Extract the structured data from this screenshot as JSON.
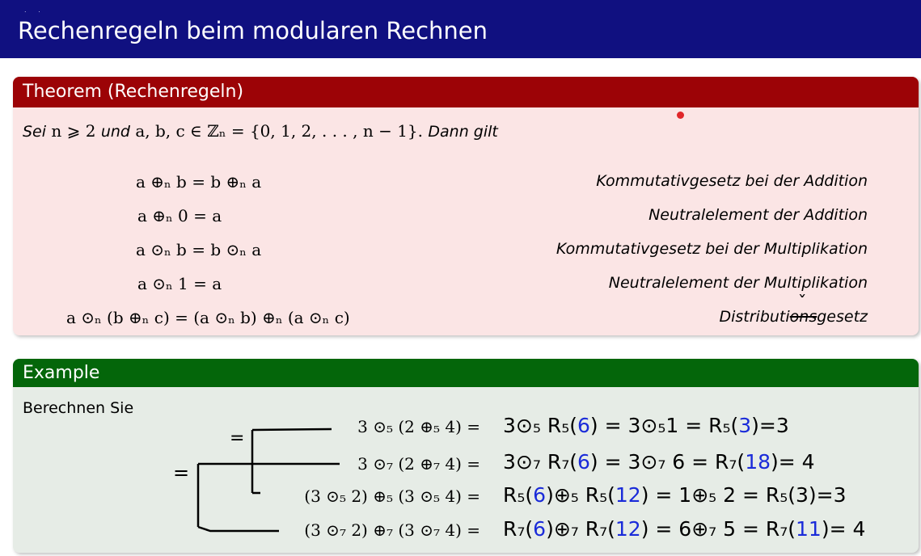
{
  "slide": {
    "title": "Rechenregeln beim modularen Rechnen",
    "nav_dots": ". ."
  },
  "theorem": {
    "heading": "Theorem (Rechenregeln)",
    "intro_sei": "Sei",
    "intro_math1": "n ⩾ 2",
    "intro_und": "und",
    "intro_math2": "a, b, c ∈ ℤₙ = {0, 1, 2, . . . , n − 1}.",
    "intro_dann": "Dann gilt",
    "rules": [
      {
        "formula": "a ⊕ₙ b = b ⊕ₙ a",
        "name": "Kommutativgesetz bei der Addition"
      },
      {
        "formula": "a ⊕ₙ 0 = a",
        "name": "Neutralelement der Addition"
      },
      {
        "formula": "a ⊙ₙ b = b ⊙ₙ a",
        "name": "Kommutativgesetz bei der Multiplikation"
      },
      {
        "formula": "a ⊙ₙ 1 = a",
        "name": "Neutralelement der Multiplikation"
      },
      {
        "formula": "a ⊙ₙ (b ⊕ₙ c) = (a ⊙ₙ b) ⊕ₙ (a ⊙ₙ c)",
        "name_prefix": "Distributi",
        "name_struck": "ons",
        "name_suffix": "gesetz",
        "name_insert": "ˇ"
      }
    ]
  },
  "example": {
    "heading": "Example",
    "prompt": "Berechnen Sie",
    "tasks": [
      {
        "expr": "3 ⊙₅ (2 ⊕₅ 4) =",
        "work": [
          "3⊙₅ R₅(",
          "6",
          ") = 3⊙₅1 = R₅(",
          "3",
          ")=3"
        ]
      },
      {
        "expr": "3 ⊙₇ (2 ⊕₇ 4) =",
        "work": [
          "3⊙₇ R₇(",
          "6",
          ") = 3⊙₇ 6 = R₇(",
          "18",
          ")= 4"
        ]
      },
      {
        "expr": "(3 ⊙₅ 2) ⊕₅ (3 ⊙₅ 4) =",
        "work": [
          "R₅(",
          "6",
          ")⊕₅ R₅(",
          "12",
          ") = 1⊕₅ 2 = R₅(3)=3"
        ]
      },
      {
        "expr": "(3 ⊙₇ 2) ⊕₇ (3 ⊙₇ 4) =",
        "work": [
          "R₇(",
          "6",
          ")⊕₇ R₇(",
          "12",
          ") = 6⊕₇ 5 = R₇(",
          "11",
          ")= 4"
        ]
      }
    ],
    "eq_sign_1": "=",
    "eq_sign_2": "="
  },
  "colors": {
    "title_bar": "#101080",
    "theorem_header": "#9c0306",
    "theorem_body": "#fbe5e5",
    "example_header": "#04660a",
    "example_body": "#e6ece6",
    "handwriting_blue": "#1a2bd9",
    "pointer": "#e0262a"
  }
}
